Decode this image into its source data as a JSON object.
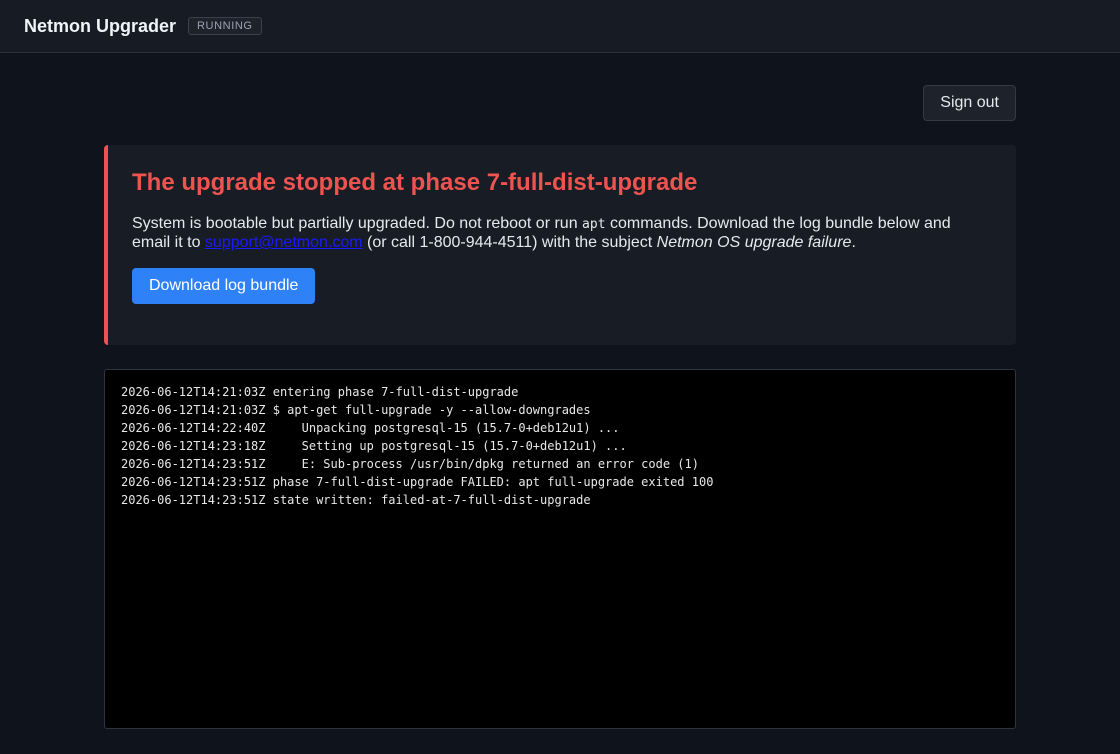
{
  "header": {
    "app_title": "Netmon Upgrader",
    "status": "RUNNING"
  },
  "actions": {
    "signout_label": "Sign out"
  },
  "error": {
    "title": "The upgrade stopped at phase 7-full-dist-upgrade",
    "message_part1": "System is bootable but partially upgraded. Do not reboot or run ",
    "code_word": "apt",
    "message_part2": " commands. Download the log bundle below and email it to ",
    "email": "support@netmon.com",
    "message_part3": " (or call 1-800-944-4511) with the subject ",
    "subject": "Netmon OS upgrade failure",
    "message_end": ".",
    "download_label": "Download log bundle"
  },
  "log": {
    "lines": [
      "2026-06-12T14:21:03Z entering phase 7-full-dist-upgrade",
      "2026-06-12T14:21:03Z $ apt-get full-upgrade -y --allow-downgrades",
      "2026-06-12T14:22:40Z     Unpacking postgresql-15 (15.7-0+deb12u1) ...",
      "2026-06-12T14:23:18Z     Setting up postgresql-15 (15.7-0+deb12u1) ...",
      "2026-06-12T14:23:51Z     E: Sub-process /usr/bin/dpkg returned an error code (1)",
      "2026-06-12T14:23:51Z phase 7-full-dist-upgrade FAILED: apt full-upgrade exited 100",
      "2026-06-12T14:23:51Z state written: failed-at-7-full-dist-upgrade"
    ]
  }
}
